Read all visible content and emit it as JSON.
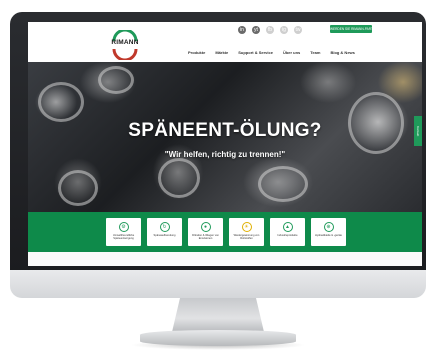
{
  "header": {
    "logo_text": "RIMANN",
    "top_icons": [
      "in",
      "yt",
      "fb",
      "ig",
      "tw"
    ],
    "cta": "WERDEN SIE RIMANN-PARTNER",
    "nav": [
      "Produkte",
      "Märkte",
      "Support & Service",
      "Über uns",
      "Team",
      "Blog & News"
    ]
  },
  "hero": {
    "title": "SPÄNEENT-ÖLUNG?",
    "subtitle": "\"Wir helfen, richtig zu trennen!\"",
    "side_tab": "Kontakt"
  },
  "features": [
    {
      "icon": "gear-icon",
      "label": "Umweltfreundliche Späneentsorgung"
    },
    {
      "icon": "recycle-icon",
      "label": "Späneaufbereitung"
    },
    {
      "icon": "oil-drop-icon",
      "label": "Filtration & Wiegen von Emulsionen"
    },
    {
      "icon": "sun-icon",
      "label": "Wiedergewinnung von Rohstoffen"
    },
    {
      "icon": "factory-icon",
      "label": "Industrieprodukte"
    },
    {
      "icon": "cart-icon",
      "label": "Hydraulikteile & -geräte"
    }
  ],
  "colors": {
    "brand_green": "#0e8a4a",
    "accent_green": "#1f9a5a",
    "monitor_bezel": "#1a1b1e"
  }
}
